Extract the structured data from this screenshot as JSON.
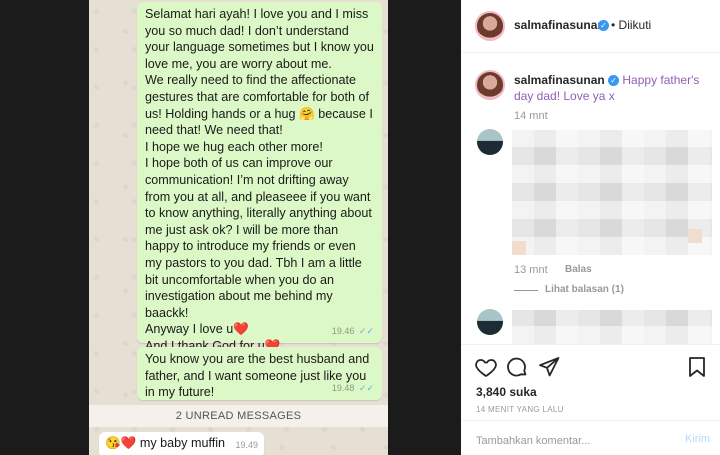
{
  "whatsapp": {
    "messages": [
      {
        "text": "Selamat hari ayah! I love you and I miss you so much dad! I don’t understand your language sometimes but I know you love me, you are worry about me.\nWe really need to find the affectionate gestures that are comfortable for both of us! Holding hands or a hug 🤗 because I need that! We need that!\nI hope we hug each other more!\nI hope both of us can improve our communication! I’m not drifting away from you at all, and pleaseee if you want to know anything, literally anything about me just ask ok? I will be more than happy to introduce my friends or even my pastors to you dad. Tbh I am a little bit uncomfortable when you do an investigation about me behind my baackk!\nAnyway I love u❤️\nAnd I thank God for u❤️\nAnd I will always pray for u❤️",
        "time": "19.46"
      },
      {
        "text": "You know you are the best husband and father, and I want someone just like you in my future!",
        "time": "19.48"
      }
    ],
    "unread_label": "2 UNREAD MESSAGES",
    "incoming": {
      "text": "😘❤️ my baby muffin",
      "time": "19.49"
    },
    "tick": "✓✓"
  },
  "instagram": {
    "username": "salmafinasunan",
    "verified_mark": "✓",
    "follow_sep": "•",
    "follow_status": "Diikuti",
    "caption": {
      "username": "salmafinasunan",
      "text": "Happy father's day dad! Love ya x",
      "time": "14 mnt"
    },
    "comment": {
      "time": "13 mnt",
      "reply_label": "Balas",
      "view_replies": "Lihat balasan (1)"
    },
    "likes": "3,840 suka",
    "time_ago": "14 MENIT YANG LALU",
    "comment_placeholder": "Tambahkan komentar...",
    "post_button": "Kirim",
    "icons": [
      "heart-icon",
      "comment-icon",
      "share-icon",
      "bookmark-icon"
    ],
    "colors": {
      "verified": "#3897f0",
      "post_disabled": "#b3dbff",
      "link_purple": "#8e5fb8"
    }
  }
}
